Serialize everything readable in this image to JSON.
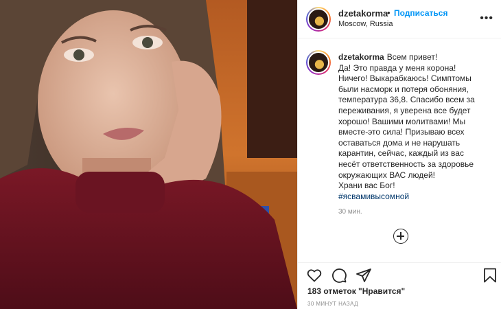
{
  "post": {
    "photo_alt": "selfie photo",
    "username": "dzetakorma",
    "dot": "•",
    "follow_label": "Подписаться",
    "location": "Moscow, Russia",
    "more_icon": "more-horizontal-icon"
  },
  "caption": {
    "username": "dzetakorma",
    "lines": [
      "Всем привет!",
      "Да! Это правда у меня корона!",
      "Ничего! Выкарабкаюсь! Симптомы",
      "были насморк и потеря обоняния,",
      "температура 36,8. Спасибо всем за",
      "переживания, я уверена все будет",
      "хорошо! Вашими молитвами! Мы",
      "вместе-это сила! Призываю всех",
      "оставаться дома и не нарушать",
      "карантин, сейчас, каждый из вас",
      "несёт ответственность за здоровье",
      "окружающих ВАС людей!",
      "Храни вас Бог!"
    ],
    "hashtag": "#ясвамивысомной",
    "time": "30 мин."
  },
  "actions": {
    "icons": [
      "heart-icon",
      "comment-icon",
      "share-icon",
      "bookmark-icon"
    ],
    "likes_text": "183 отметок \"Нравится\"",
    "date_text": "30 МИНУТ НАЗАД"
  },
  "colors": {
    "link": "#0095f6",
    "hashtag": "#00376b",
    "muted": "#8e8e8e",
    "text": "#262626"
  }
}
